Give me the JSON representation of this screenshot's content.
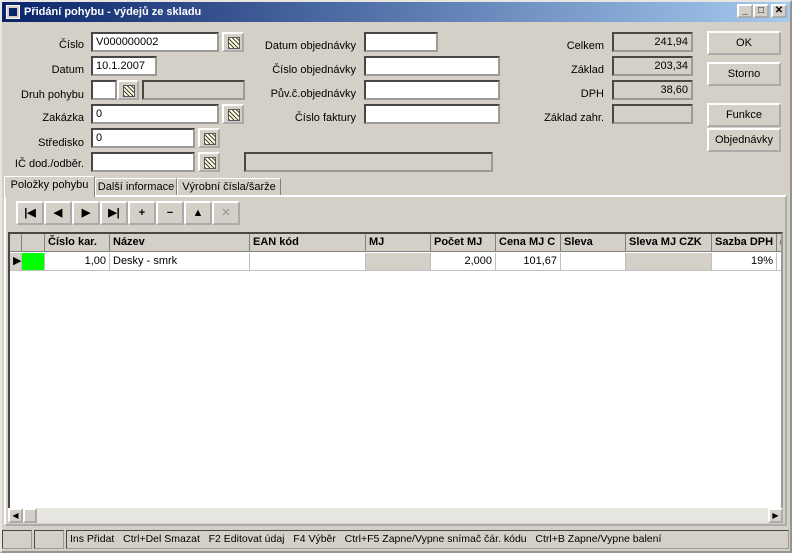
{
  "window": {
    "title": "Přidání pohybu - výdejů ze skladu"
  },
  "form": {
    "cislo_label": "Číslo",
    "cislo_value": "V000000002",
    "datum_label": "Datum",
    "datum_value": "10.1.2007",
    "druh_label": "Druh pohybu",
    "druh_value": "",
    "zakazka_label": "Zakázka",
    "zakazka_value": "0",
    "stredisko_label": "Středisko",
    "stredisko_value": "0",
    "ic_label": "IČ dod./odběr.",
    "ic_value": "",
    "datum_obj_label": "Datum objednávky",
    "datum_obj_value": "",
    "cislo_obj_label": "Číslo objednávky",
    "cislo_obj_value": "",
    "puv_obj_label": "Pův.č.objednávky",
    "puv_obj_value": "",
    "cislo_fakt_label": "Číslo faktury",
    "cislo_fakt_value": ""
  },
  "totals": {
    "celkem_label": "Celkem",
    "celkem_value": "241,94",
    "zaklad_label": "Základ",
    "zaklad_value": "203,34",
    "dph_label": "DPH",
    "dph_value": "38,60",
    "zaklad_zahr_label": "Základ zahr.",
    "zaklad_zahr_value": ""
  },
  "buttons": {
    "ok": "OK",
    "storno": "Storno",
    "funkce": "Funkce",
    "objednavky": "Objednávky"
  },
  "tabs": [
    "Položky pohybu",
    "Další informace",
    "Výrobní čísla/šarže"
  ],
  "nav": [
    "|◀",
    "◀",
    "▶",
    "▶|",
    "+",
    "−",
    "▲",
    "✕"
  ],
  "grid": {
    "columns": [
      "Číslo kar.",
      "Název",
      "EAN kód",
      "MJ",
      "Počet MJ",
      "Cena MJ C",
      "Sleva",
      "Sleva MJ CZK",
      "Sazba DPH",
      "("
    ],
    "rows": [
      [
        "1,00",
        "Desky - smrk",
        "",
        "",
        "2,000",
        "101,67",
        "",
        "",
        "19%",
        ""
      ]
    ]
  },
  "statusbar": [
    "Ins Přidat",
    "Ctrl+Del Smazat",
    "F2 Editovat údaj",
    "F4 Výběr",
    "Ctrl+F5 Zapne/Vypne snímač čár. kódu",
    "Ctrl+B Zapne/Vypne balení"
  ]
}
